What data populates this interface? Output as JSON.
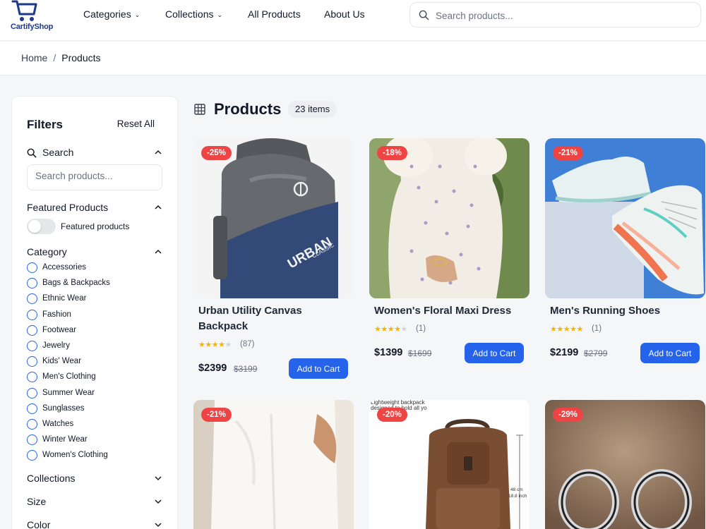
{
  "brand": {
    "name": "CartifyShop",
    "color": "#1e3a8a"
  },
  "nav": {
    "categories": "Categories",
    "collections": "Collections",
    "all_products": "All Products",
    "about": "About Us"
  },
  "search": {
    "placeholder": "Search products..."
  },
  "breadcrumb": {
    "home": "Home",
    "sep": "/",
    "current": "Products"
  },
  "filters": {
    "title": "Filters",
    "reset": "Reset All",
    "search_section": "Search",
    "search_placeholder": "Search products...",
    "featured_section": "Featured Products",
    "featured_toggle_label": "Featured products",
    "featured_on": false,
    "category_section": "Category",
    "categories": [
      "Accessories",
      "Bags & Backpacks",
      "Ethnic Wear",
      "Fashion",
      "Footwear",
      "Jewelry",
      "Kids' Wear",
      "Men's Clothing",
      "Summer Wear",
      "Sunglasses",
      "Watches",
      "Winter Wear",
      "Women's Clothing"
    ],
    "collections_section": "Collections",
    "size_section": "Size",
    "color_section": "Color"
  },
  "main": {
    "title": "Products",
    "count": "23 items"
  },
  "products": [
    {
      "name": "Urban Utility Canvas Backpack",
      "discount": "-25%",
      "rating": 4,
      "reviews": "(87)",
      "price": "$2399",
      "old_price": "$3199",
      "cta": "Add to Cart"
    },
    {
      "name": "Women's Floral Maxi Dress",
      "discount": "-18%",
      "rating": 4,
      "reviews": "(1)",
      "price": "$1399",
      "old_price": "$1699",
      "cta": "Add to Cart"
    },
    {
      "name": "Men's Running Shoes",
      "discount": "-21%",
      "rating": 5,
      "reviews": "(1)",
      "price": "$2199",
      "old_price": "$2799",
      "cta": "Add to Cart"
    },
    {
      "discount": "-21%"
    },
    {
      "discount": "-20%",
      "img_text": "Lightweight backpack designed to hold all yo",
      "dim_cm": "48 cm",
      "dim_in": "18.8 inch"
    },
    {
      "discount": "-29%"
    }
  ],
  "colors": {
    "accent": "#2563eb",
    "discount": "#ef4444",
    "star": "#f5b400"
  }
}
